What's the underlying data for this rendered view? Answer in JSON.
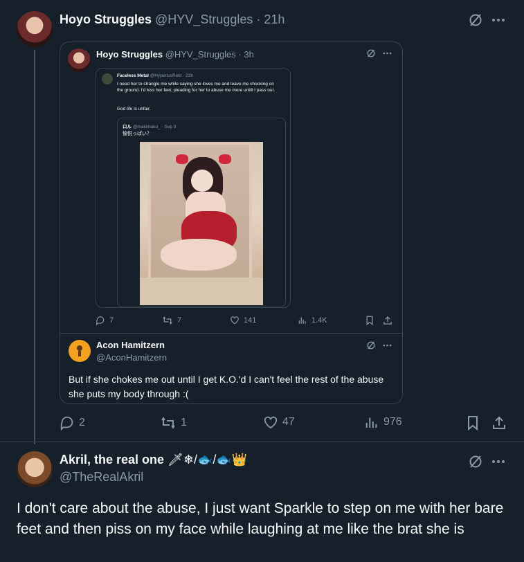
{
  "main_post": {
    "name": "Hoyo Struggles",
    "handle": "@HYV_Struggles",
    "time": "· 21h",
    "stats": {
      "replies": "2",
      "reposts": "1",
      "likes": "47",
      "views": "976"
    }
  },
  "quote_post": {
    "name": "Hoyo Struggles",
    "handle": "@HYV_Struggles",
    "time": "· 3h",
    "stats": {
      "replies": "7",
      "reposts": "7",
      "likes": "141",
      "views": "1.4K"
    }
  },
  "nested_quote": {
    "name": "Faceless Metal",
    "handle": "@HyperiusRekt · 23h",
    "text": "I need her to strangle me while saying she loves me and leave me chocking on the ground. I'd kiss her feet, pleading for her to abuse me more untill I pass out.",
    "text2": "God life is unfair.",
    "inner": {
      "name": "ロル",
      "handle": "@makimaku_ · Sep 3",
      "text": "愉悦っぱい？"
    }
  },
  "quote_reply": {
    "name": "Acon Hamitzern",
    "handle": "@AconHamitzern",
    "text": "But if she chokes me out until I get K.O.'d I can't feel the rest of the abuse she puts my body through :("
  },
  "reply": {
    "name": "Akril, the real one",
    "emojis": "🗡❄/🐟/🐟👑",
    "handle": "@TheRealAkril",
    "text": "I don't care about the abuse, I just want Sparkle to step on me with her bare feet and then piss on my face while laughing at me like the brat she is"
  },
  "colors": {
    "background": "#15202b",
    "border": "#38444d",
    "muted": "#8b98a5",
    "text": "#f7f9f9"
  }
}
